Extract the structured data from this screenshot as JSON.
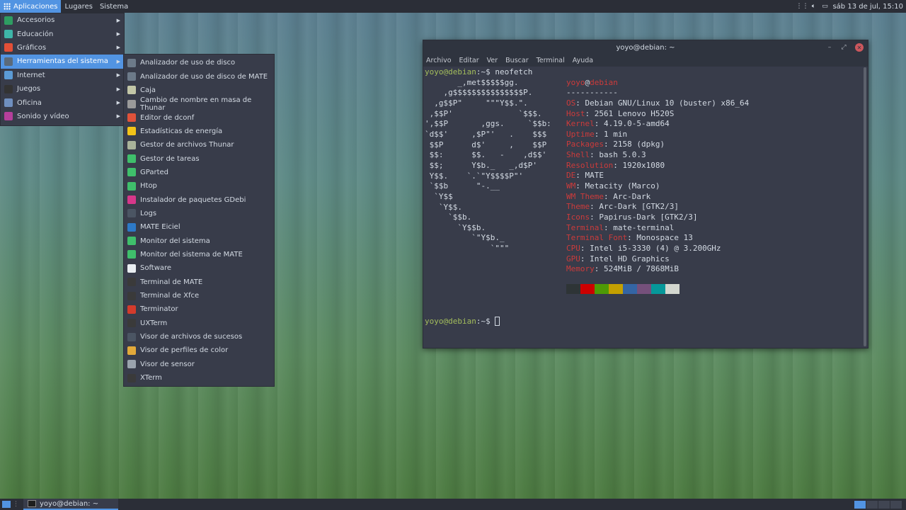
{
  "top_panel": {
    "menus": [
      "Aplicaciones",
      "Lugares",
      "Sistema"
    ],
    "clock": "sáb 13 de jul, 15:10"
  },
  "app_menu": {
    "categories": [
      {
        "label": "Accesorios",
        "icon": "accessories-icon",
        "color": "#2e9d62"
      },
      {
        "label": "Educación",
        "icon": "education-icon",
        "color": "#3eb5a8"
      },
      {
        "label": "Gráficos",
        "icon": "graphics-icon",
        "color": "#e24f37"
      },
      {
        "label": "Herramientas del sistema",
        "icon": "system-tools-icon",
        "color": "#5b6a7a"
      },
      {
        "label": "Internet",
        "icon": "internet-icon",
        "color": "#5b9bd5"
      },
      {
        "label": "Juegos",
        "icon": "games-icon",
        "color": "#333333"
      },
      {
        "label": "Oficina",
        "icon": "office-icon",
        "color": "#6f8fbf"
      },
      {
        "label": "Sonido y vídeo",
        "icon": "multimedia-icon",
        "color": "#b53f9b"
      }
    ],
    "selected_index": 3
  },
  "submenu": {
    "items": [
      {
        "label": "Analizador de uso de disco",
        "icon": "disk-usage-icon",
        "color": "#6c7a89"
      },
      {
        "label": "Analizador de uso de disco de MATE",
        "icon": "disk-usage-mate-icon",
        "color": "#6c7a89"
      },
      {
        "label": "Caja",
        "icon": "file-manager-icon",
        "color": "#c2c6a7"
      },
      {
        "label": "Cambio de nombre en masa de Thunar",
        "icon": "bulk-rename-icon",
        "color": "#9a9a9a"
      },
      {
        "label": "Editor de dconf",
        "icon": "dconf-editor-icon",
        "color": "#e0523a"
      },
      {
        "label": "Estadísticas de energía",
        "icon": "power-stats-icon",
        "color": "#f2c318"
      },
      {
        "label": "Gestor de archivos Thunar",
        "icon": "thunar-icon",
        "color": "#a9b39a"
      },
      {
        "label": "Gestor de tareas",
        "icon": "task-manager-icon",
        "color": "#3fbf6b"
      },
      {
        "label": "GParted",
        "icon": "gparted-icon",
        "color": "#3fbf6b"
      },
      {
        "label": "Htop",
        "icon": "htop-icon",
        "color": "#3fbf6b"
      },
      {
        "label": "Instalador de paquetes GDebi",
        "icon": "gdebi-icon",
        "color": "#d6378a"
      },
      {
        "label": "Logs",
        "icon": "logs-icon",
        "color": "#4b5563"
      },
      {
        "label": "MATE Eiciel",
        "icon": "eiciel-icon",
        "color": "#2d79c7"
      },
      {
        "label": "Monitor del sistema",
        "icon": "system-monitor-icon",
        "color": "#3fbf6b"
      },
      {
        "label": "Monitor del sistema de MATE",
        "icon": "mate-system-monitor-icon",
        "color": "#3fbf6b"
      },
      {
        "label": "Software",
        "icon": "software-icon",
        "color": "#e9eef2"
      },
      {
        "label": "Terminal de MATE",
        "icon": "mate-terminal-icon",
        "color": "#3a3a3a"
      },
      {
        "label": "Terminal de Xfce",
        "icon": "xfce-terminal-icon",
        "color": "#3a3a3a"
      },
      {
        "label": "Terminator",
        "icon": "terminator-icon",
        "color": "#d33b2c"
      },
      {
        "label": "UXTerm",
        "icon": "uxterm-icon",
        "color": "#3a3a3a"
      },
      {
        "label": "Visor de archivos de sucesos",
        "icon": "log-viewer-icon",
        "color": "#4b5563"
      },
      {
        "label": "Visor de perfiles de color",
        "icon": "color-profile-icon",
        "color": "#e2a93a"
      },
      {
        "label": "Visor de sensor",
        "icon": "sensor-viewer-icon",
        "color": "#9aa3ad"
      },
      {
        "label": "XTerm",
        "icon": "xterm-icon",
        "color": "#3a3a3a"
      }
    ]
  },
  "terminal": {
    "title": "yoyo@debian: ~",
    "menus": [
      "Archivo",
      "Editar",
      "Ver",
      "Buscar",
      "Terminal",
      "Ayuda"
    ],
    "prompt_user": "yoyo@debian",
    "prompt_suffix": ":~$ ",
    "command": "neofetch",
    "ascii": "       _,met$$$$$gg.\n    ,g$$$$$$$$$$$$$$$P.\n  ,g$$P\"     \"\"\"Y$$.\".\n ,$$P'              `$$$.\n',$$P       ,ggs.     `$$b:\n`d$$'     ,$P\"'   .    $$$\n $$P      d$'     ,    $$P\n $$:      $$.   -    ,d$$'\n $$;      Y$b._   _,d$P'\n Y$$.    `.`\"Y$$$$P\"'\n `$$b      \"-.__\n  `Y$$\n   `Y$$.\n     `$$b.\n       `Y$$b.\n          `\"Y$b._\n              `\"\"\"",
    "info_host": {
      "user": "yoyo",
      "at": "@",
      "host": "debian"
    },
    "separator": "-----------",
    "info": [
      {
        "key": "OS",
        "value": "Debian GNU/Linux 10 (buster) x86_64"
      },
      {
        "key": "Host",
        "value": "2561 Lenovo H520S"
      },
      {
        "key": "Kernel",
        "value": "4.19.0-5-amd64"
      },
      {
        "key": "Uptime",
        "value": "1 min"
      },
      {
        "key": "Packages",
        "value": "2158 (dpkg)"
      },
      {
        "key": "Shell",
        "value": "bash 5.0.3"
      },
      {
        "key": "Resolution",
        "value": "1920x1080"
      },
      {
        "key": "DE",
        "value": "MATE"
      },
      {
        "key": "WM",
        "value": "Metacity (Marco)"
      },
      {
        "key": "WM Theme",
        "value": "Arc-Dark"
      },
      {
        "key": "Theme",
        "value": "Arc-Dark [GTK2/3]"
      },
      {
        "key": "Icons",
        "value": "Papirus-Dark [GTK2/3]"
      },
      {
        "key": "Terminal",
        "value": "mate-terminal"
      },
      {
        "key": "Terminal Font",
        "value": "Monospace 13"
      },
      {
        "key": "CPU",
        "value": "Intel i5-3330 (4) @ 3.200GHz"
      },
      {
        "key": "GPU",
        "value": "Intel HD Graphics"
      },
      {
        "key": "Memory",
        "value": "524MiB / 7868MiB"
      }
    ],
    "swatches": [
      "#2e3436",
      "#cc0000",
      "#4e9a06",
      "#c4a000",
      "#3465a4",
      "#75507b",
      "#06989a",
      "#d3d7cf"
    ],
    "colors": {
      "prompt": "#a4be5c",
      "key": "#cc3b3b"
    }
  },
  "bottom_panel": {
    "task": "yoyo@debian: ~",
    "workspaces": 4,
    "active_workspace": 0
  }
}
